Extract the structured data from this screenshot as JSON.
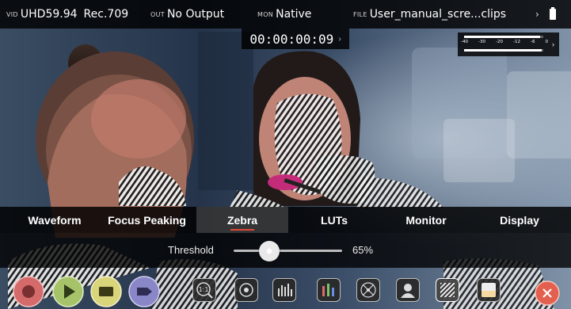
{
  "status_bar": {
    "vid_tag": "VID",
    "vid_format": "UHD59.94",
    "vid_colorspace": "Rec.709",
    "out_tag": "OUT",
    "out_value": "No Output",
    "mon_tag": "MON",
    "mon_value": "Native",
    "file_tag": "FILE",
    "file_value": "User_manual_scre...clips",
    "more_icon": "chevron-right-icon",
    "battery_icon": "battery-icon"
  },
  "timecode": {
    "value": "00:00:00:09",
    "chevron": "›"
  },
  "audio_meter": {
    "scale": [
      "-40",
      "-30",
      "-20",
      "-12",
      "-6",
      "0"
    ],
    "levels": [
      0.96,
      0.98
    ],
    "chevron": "›"
  },
  "menu": {
    "tabs": [
      {
        "label": "Waveform"
      },
      {
        "label": "Focus Peaking"
      },
      {
        "label": "Zebra",
        "active": true
      },
      {
        "label": "LUTs"
      },
      {
        "label": "Monitor"
      },
      {
        "label": "Display"
      }
    ]
  },
  "zebra": {
    "threshold_label": "Threshold",
    "threshold_value": "65%",
    "threshold_fraction": 0.33
  },
  "toolbar": {
    "buttons": [
      {
        "name": "record-button",
        "icon": "record-icon"
      },
      {
        "name": "play-button",
        "icon": "play-icon"
      },
      {
        "name": "monitor-mode-button",
        "icon": "monitor-icon"
      },
      {
        "name": "tag-button",
        "icon": "tag-icon"
      },
      {
        "name": "one-to-one-button",
        "icon": "magnify-1to1-icon",
        "text": "1:1"
      },
      {
        "name": "focus-peaking-button",
        "icon": "focus-peaking-icon"
      },
      {
        "name": "waveform-button",
        "icon": "waveform-icon"
      },
      {
        "name": "rgb-parade-button",
        "icon": "rgb-parade-icon"
      },
      {
        "name": "vectorscope-button",
        "icon": "vectorscope-icon"
      },
      {
        "name": "false-color-button",
        "icon": "false-color-icon"
      },
      {
        "name": "zebra-button",
        "icon": "zebra-icon"
      },
      {
        "name": "blue-only-button",
        "icon": "blue-only-icon"
      }
    ],
    "more_icon": "chevron-right-icon",
    "close_icon": "close-icon",
    "colors": {
      "record": "#d46a6a",
      "play": "#a7c36a",
      "monitor": "#d8d57a",
      "tag": "#8a87c8",
      "close": "#e3604f",
      "active_tab_underline": "#e0473a"
    }
  }
}
